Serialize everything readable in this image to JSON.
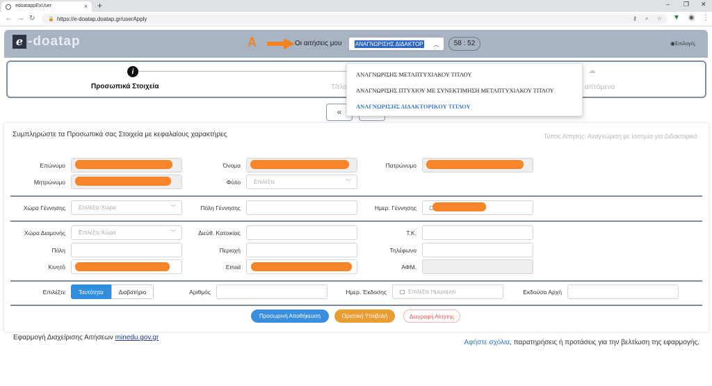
{
  "browser": {
    "tab_title": "edoatappExUser",
    "tab_close": "×",
    "new_tab": "+",
    "url": "https://e-doatap.doatap.gr/userApply",
    "window_controls": [
      "–",
      "❐",
      "✕"
    ]
  },
  "header": {
    "logo_e": "e",
    "logo_text": "-doatap",
    "marker": "A",
    "apps_label": "Οι αιτήσεις μου",
    "apps_selected": "ΑΝΑΓΝΩΡΙΣΗΣ ΔΙΔΑΚΤΟΡ",
    "timer": "58 : 52",
    "options_label": "Επιλογές",
    "accent_color": "#f58220"
  },
  "dropdown": {
    "items": [
      "ΑΝΑΓΝΩΡΙΣΗΣ ΜΕΤΑΠΤΥΧΙΑΚΟΥ ΤΙΤΛΟΥ",
      "ΑΝΑΓΝΩΡΙΣΗΣ ΠΤΥΧΙΟΥ ΜΕ ΣΥΝΕΚΤΙΜΗΣΗ ΜΕΤΑΠΤΥΧΙΑΚΟΥ ΤΙΤΛΟΥ",
      "ΑΝΑΓΝΩΡΙΣΗΣ ΔΙΔΑΚΤΟΡΙΚΟΥ ΤΙΤΛΟΥ"
    ]
  },
  "steps": {
    "step1_icon": "i",
    "step1_label": "Προσωπικά Στοιχεία",
    "step2_label": "Τίτλο",
    "step3_label": "απτόμενα",
    "prev": "«"
  },
  "form": {
    "title": "Συμπληρώστε τα Προσωπικά σας Στοιχεία με κεφαλαίους χαρακτήρες",
    "app_type": "Τύπος Αίτησης: Αναγνώριση με Ισοτιμία για Διδακτορικό",
    "labels": {
      "surname": "Επώνυμο",
      "name": "Όνομα",
      "father": "Πατρώνυμο",
      "mother": "Μητρώνυμο",
      "gender": "Φύλο",
      "birth_country": "Χώρα Γέννησης",
      "birth_city": "Πόλη Γέννησης",
      "birth_date": "Ημερ. Γέννησης",
      "res_country": "Χώρα Διαμονής",
      "address": "Διεύθ. Κατοικίας",
      "zip": "Τ.Κ.",
      "city": "Πόλη",
      "region": "Περιοχή",
      "phone": "Τηλέφωνο",
      "mobile": "Κινητό",
      "email": "Email",
      "afm": "ΑΦΜ.",
      "select": "Επιλέξτε",
      "number": "Αριθμός",
      "issue_date": "Ημερ. Έκδοσης",
      "authority": "Εκδούσα Αρχή"
    },
    "placeholders": {
      "gender": "Επιλέξτε",
      "birth_country": "Επιλέξτε Χώρα",
      "res_country": "Επιλέξτε Χώρα",
      "issue_date": "Επιλέξτε Ημερομην"
    },
    "toggle": {
      "id_card": "Ταυτότητα",
      "passport": "Διαβατήριο"
    },
    "buttons": {
      "save": "Προσωρινή Αποθήκευση",
      "submit": "Οριστική Υποβολή",
      "delete": "Διαγραφή Αίτησης"
    },
    "redaction_color": "#f7852a"
  },
  "footer": {
    "left_text": "Εφαρμογή Διαχείρισης Αιτήσεων",
    "left_link": "minedu.gov.gr",
    "right_link": "Αφήστε σχόλια",
    "right_text": ", παρατηρήσεις ή προτάσεις για την βελτίωση της εφαρμογής."
  }
}
